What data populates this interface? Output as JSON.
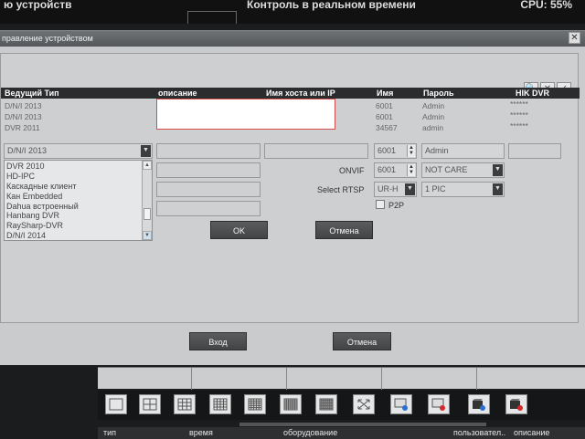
{
  "topbar": {
    "left_text": "ю устройств",
    "center_text": "Контроль в реальном времени",
    "right_text": "CPU: 55%"
  },
  "panel": {
    "title": "правление устройством",
    "close_icon": "close-icon"
  },
  "toolbar_icons": [
    "search-icon",
    "delete-icon",
    "check-icon"
  ],
  "table": {
    "headers": [
      "Ведущий Тип",
      "описание",
      "Имя хоста или IP",
      "Имя",
      "Пароль",
      "HIK DVR"
    ],
    "rows": [
      {
        "type": "D/N/I 2013",
        "name": "6001",
        "password": "Admin",
        "hik": "******"
      },
      {
        "type": "D/N/I 2013",
        "name": "6001",
        "password": "Admin",
        "hik": "******"
      },
      {
        "type": "DVR 2011",
        "name": "34567",
        "password": "admin",
        "hik": "******"
      }
    ]
  },
  "form": {
    "device_type": "D/N/I 2013",
    "name_value": "6001",
    "password_value": "Admin",
    "onvif_label": "ONVIF",
    "onvif_value": "6001",
    "onvif_select": "NOT CARE",
    "rtsp_label": "Select RTSP",
    "rtsp_value": "UR-H",
    "rtsp_select": "1 PIC",
    "p2p_label": "P2P",
    "ok_label": "OK",
    "cancel_label": "Отмена"
  },
  "dropdown_items": [
    "DVR 2010",
    "HD-IPC",
    "Каскадные клиент",
    "Кан Embedded",
    "Dahua встроенный",
    "Hanbang DVR",
    "RaySharp-DVR",
    "D/N/I 2014"
  ],
  "footer": {
    "login_label": "Вход",
    "cancel_label": "Отмена"
  },
  "bottom_table": {
    "headers": [
      "тип",
      "время",
      "оборудование",
      "пользовател..",
      "описание"
    ]
  }
}
